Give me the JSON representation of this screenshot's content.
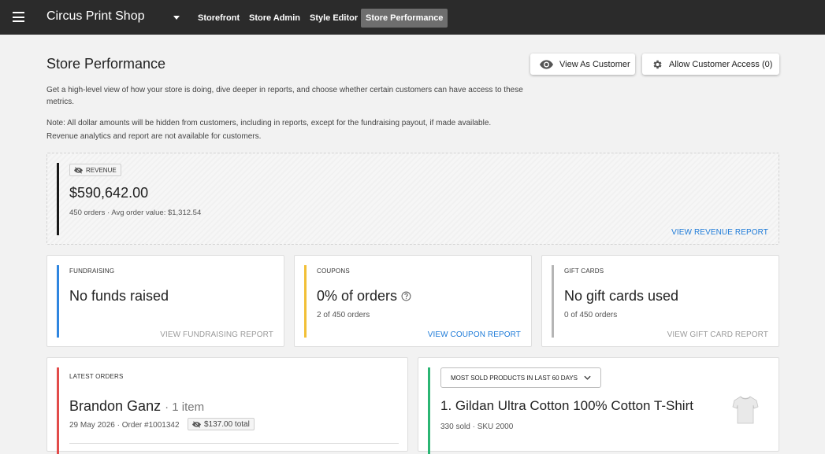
{
  "topbar": {
    "shop_name": "Circus Print Shop",
    "tabs": [
      {
        "label": "Storefront"
      },
      {
        "label": "Store Admin"
      },
      {
        "label": "Style Editor"
      },
      {
        "label": "Store Performance"
      }
    ],
    "active_tab": "Store Performance"
  },
  "header": {
    "title": "Store Performance",
    "view_as_customer_label": "View As Customer",
    "allow_access_label": "Allow Customer Access (0)",
    "description": "Get a high-level view of how your store is doing, dive deeper in reports, and choose whether certain customers can have access to these metrics.",
    "note_line1": "Note: All dollar amounts will be hidden from customers, including in reports, except for the fundraising payout, if made available.",
    "note_line2": "Revenue analytics and report are not available for customers."
  },
  "revenue": {
    "badge": "REVENUE",
    "amount": "$590,642.00",
    "details": "450 orders · Avg order value: $1,312.54",
    "link": "VIEW REVENUE REPORT",
    "accent_color": "#1a1a1a"
  },
  "fundraising": {
    "label": "FUNDRAISING",
    "value": "No funds raised",
    "link": "VIEW FUNDRAISING REPORT",
    "accent_color": "#2f86e0"
  },
  "coupons": {
    "label": "COUPONS",
    "value": "0% of orders",
    "details": "2 of 450 orders",
    "link": "VIEW COUPON REPORT",
    "accent_color": "#f2c037"
  },
  "gift_cards": {
    "label": "GIFT CARDS",
    "value": "No gift cards used",
    "details": "0 of 450 orders",
    "link": "VIEW GIFT CARD REPORT",
    "accent_color": "#b5b5b5"
  },
  "latest_orders": {
    "label": "LATEST ORDERS",
    "customer": "Brandon Ganz",
    "items": "· 1 item",
    "meta": "29 May 2026 · Order #1001342",
    "total": "$137.00 total",
    "accent_color": "#e24c4b"
  },
  "most_sold": {
    "dropdown_label": "MOST SOLD PRODUCTS IN LAST 60 DAYS",
    "product": "1. Gildan Ultra Cotton 100% Cotton T-Shirt",
    "meta": "330 sold · SKU 2000",
    "accent_color": "#2bb573"
  },
  "icons": {
    "menu": "menu-icon",
    "dropdown": "caret-down-icon",
    "eye": "eye-icon",
    "gear": "gear-icon",
    "hidden": "eye-off-icon",
    "help": "help-circle-icon",
    "chevron": "chevron-down-icon"
  }
}
